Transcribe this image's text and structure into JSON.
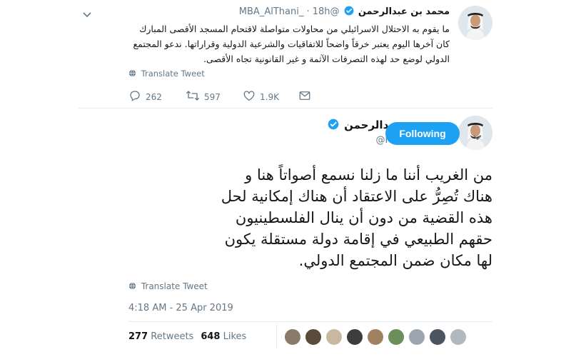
{
  "reply_tweet": {
    "author_name": "محمد بن عبدالرحمن",
    "handle": "@MBA_AlThani_",
    "separator": "·",
    "time": "18h",
    "text_lines": [
      "ما يقوم به الاحتلال الاسرائيلي من محاولات متواصلة لاقتحام المسجد الأقصى المبارك",
      "كان آخرها اليوم يعتبر خرقاً واضحاً للاتفاقيات والشرعية الدولية وقراراتها. ندعو المجتمع",
      "الدولي لوضع حد لهذه التصرفات الآثمة و غير القانونية تجاه الأقصى."
    ],
    "translate_label": "Translate Tweet",
    "replies": "262",
    "retweets": "597",
    "likes": "1.9K",
    "icons": [
      "verified-icon",
      "chevron-down-icon",
      "globe-icon",
      "reply-icon",
      "retweet-icon",
      "like-icon",
      "message-icon"
    ]
  },
  "main_tweet": {
    "author_name": "محمد بن عبدالرحمن",
    "handle": "@MBA_AlThani_",
    "follow_label": "Following",
    "text_lines": [
      "من الغريب أننا ما زلنا نسمع أصواتاً هنا و",
      "هناك تُصِرُّ على الاعتقاد أن هناك إمكانية لحل",
      "هذه القضية من دون أن ينال الفلسطينيون",
      "حقهم الطبيعي في إقامة دولة مستقلة يكون",
      "لها مكان ضمن المجتمع الدولي."
    ],
    "translate_label": "Translate Tweet",
    "timestamp": "4:18 AM - 25 Apr 2019",
    "retweet_count": "277",
    "retweet_label": "Retweets",
    "like_count": "648",
    "like_label": "Likes",
    "liker_colors": [
      "#8a7a6a",
      "#5a4a3a",
      "#c9b8a0",
      "#3d3d3d",
      "#a08060",
      "#6b8e5a",
      "#9aa5b0",
      "#4a5560",
      "#b0b8c0"
    ],
    "icons": [
      "verified-icon",
      "chevron-down-icon",
      "globe-icon"
    ]
  },
  "colors": {
    "accent": "#1da1f2",
    "text": "#14171a",
    "muted": "#657786",
    "border": "#e6ecf0"
  }
}
